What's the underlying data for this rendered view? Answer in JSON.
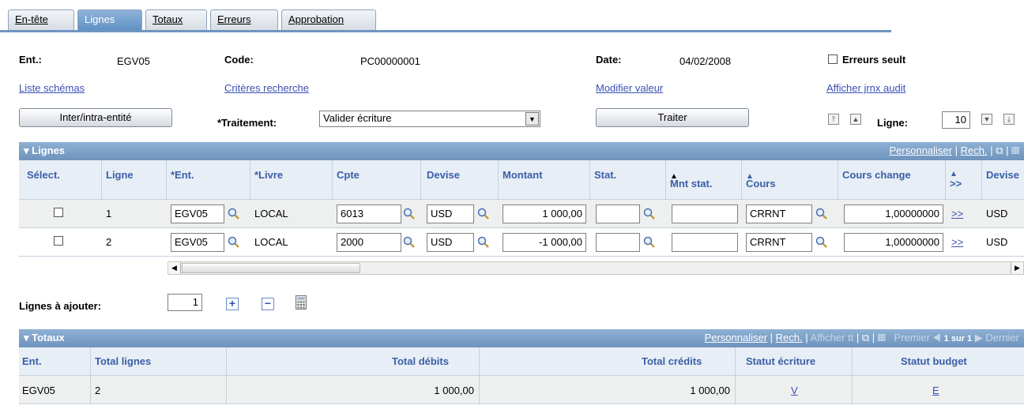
{
  "tabs": [
    {
      "label": "En-tête",
      "active": false
    },
    {
      "label": "Lignes",
      "active": true
    },
    {
      "label": "Totaux",
      "active": false
    },
    {
      "label": "Erreurs",
      "active": false
    },
    {
      "label": "Approbation",
      "active": false
    }
  ],
  "header": {
    "ent_label": "Ent.:",
    "ent_value": "EGV05",
    "code_label": "Code:",
    "code_value": "PC00000001",
    "date_label": "Date:",
    "date_value": "04/02/2008",
    "errors_only_label": "Erreurs seult",
    "errors_only_checked": false
  },
  "links": {
    "schemas": "Liste schémas",
    "search_criteria": "Critères recherche",
    "modify_value": "Modifier valeur",
    "audit_log": "Afficher jrnx audit"
  },
  "actions": {
    "inter_intra_button": "Inter/intra-entité",
    "processing_label": "*Traitement:",
    "processing_value": "Valider écriture",
    "process_button": "Traiter",
    "line_label": "Ligne:",
    "line_value": "10"
  },
  "lines_grid": {
    "title": "Lignes",
    "customize": "Personnaliser",
    "search": "Rech.",
    "columns": [
      "Sélect.",
      "Ligne",
      "*Ent.",
      "*Livre",
      "Cpte",
      "Devise",
      "Montant",
      "Stat.",
      "Mnt stat.",
      "Cours",
      "Cours change",
      ">>",
      "Devise"
    ],
    "rows": [
      {
        "selected": false,
        "line": "1",
        "ent": "EGV05",
        "book": "LOCAL",
        "account": "6013",
        "currency": "USD",
        "amount": "1 000,00",
        "stat": "",
        "stat_amount": "",
        "rate_type": "CRRNT",
        "rate": "1,00000000",
        "more": ">>",
        "currency2": "USD"
      },
      {
        "selected": false,
        "line": "2",
        "ent": "EGV05",
        "book": "LOCAL",
        "account": "2000",
        "currency": "USD",
        "amount": "-1 000,00",
        "stat": "",
        "stat_amount": "",
        "rate_type": "CRRNT",
        "rate": "1,00000000",
        "more": ">>",
        "currency2": "USD"
      }
    ]
  },
  "add_lines": {
    "label": "Lignes à ajouter:",
    "value": "1"
  },
  "totals_grid": {
    "title": "Totaux",
    "customize": "Personnaliser",
    "search": "Rech.",
    "show_all": "Afficher tt",
    "first": "Premier",
    "pagination": "1 sur 1",
    "last": "Dernier",
    "columns": [
      "Ent.",
      "Total lignes",
      "Total débits",
      "Total crédits",
      "Statut écriture",
      "Statut budget"
    ],
    "rows": [
      {
        "ent": "EGV05",
        "total_lines": "2",
        "total_debits": "1 000,00",
        "total_credits": "1 000,00",
        "entry_status": "V",
        "budget_status": "E"
      }
    ]
  }
}
